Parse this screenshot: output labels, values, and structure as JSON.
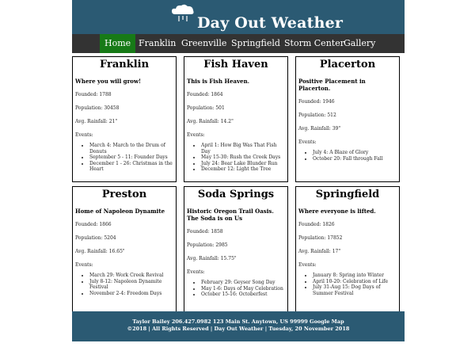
{
  "site": {
    "title": "Day Out Weather",
    "logo_icon": "cloud-umbrella-icon"
  },
  "nav": [
    {
      "label": "Home",
      "active": true
    },
    {
      "label": "Franklin",
      "active": false
    },
    {
      "label": "Greenville",
      "active": false
    },
    {
      "label": "Springfield",
      "active": false
    },
    {
      "label": "Storm Center",
      "active": false
    },
    {
      "label": "Gallery",
      "active": false
    }
  ],
  "towns": [
    {
      "name": "Franklin",
      "tagline": "Where you will grow!",
      "founded": "Founded: 1788",
      "population": "Population: 30458",
      "rainfall": "Avg. Rainfall: 21\"",
      "events_label": "Events:",
      "events": [
        "March 4: March to the Drum of Donuts",
        "September 5 - 11: Founder Days",
        "December 1 - 26: Christmas in the Heart"
      ]
    },
    {
      "name": "Fish Haven",
      "tagline": "This is Fish Heaven.",
      "founded": "Founded: 1864",
      "population": "Population: 501",
      "rainfall": "Avg. Rainfall: 14.2\"",
      "events_label": "Events:",
      "events": [
        "April 1: How Big Was That Fish Day",
        "May 15-30: Rush the Creek Days",
        "July 24: Bear Lake Blunder Run",
        "December 12: Light the Tree"
      ]
    },
    {
      "name": "Placerton",
      "tagline": "Positive Placement in Placerton.",
      "founded": "Founded: 1946",
      "population": "Population: 512",
      "rainfall": "Avg. Rainfall: 39\"",
      "events_label": "Events:",
      "events": [
        "July 4: A Blaze of Glory",
        "October 20: Fall through Fall"
      ]
    },
    {
      "name": "Preston",
      "tagline": "Home of Napoleon Dynamite",
      "founded": "Founded: 1866",
      "population": "Population: 5204",
      "rainfall": "Avg. Rainfall: 16.65\"",
      "events_label": "Events:",
      "events": [
        "March 29: Work Creek Revival",
        "July 8-12: Napoleon Dynamite Festival",
        "November 2-4: Freedom Days"
      ]
    },
    {
      "name": "Soda Springs",
      "tagline": "Historic Oregon Trail Oasis. The Soda is on Us",
      "founded": "Founded: 1858",
      "population": "Population: 2985",
      "rainfall": "Avg. Rainfall: 15.75\"",
      "events_label": "Events:",
      "events": [
        "February 29: Geyser Song Day",
        "May 1-6: Days of May Celebration",
        "October 15-16: Octoberfest"
      ]
    },
    {
      "name": "Springfield",
      "tagline": "Where everyone is lifted.",
      "founded": "Founded: 1826",
      "population": "Population: 17852",
      "rainfall": "Avg. Rainfall: 17\"",
      "events_label": "Events:",
      "events": [
        "January 8: Spring into Winter",
        "April 10-20: Celebration of Life",
        "July 31-Aug 15: Dog Days of Summer Festival"
      ]
    }
  ],
  "footer": {
    "line1": "Taylor Bailey 206.427.0982 123 Main St. Anytown, US 99999 Google Map",
    "line2": "©2018 | All Rights Reserved | Day Out Weather | Tuesday, 20 November 2018"
  },
  "colors": {
    "header_bg": "#2b5a73",
    "nav_bg": "#333333",
    "nav_active": "#177a17"
  }
}
